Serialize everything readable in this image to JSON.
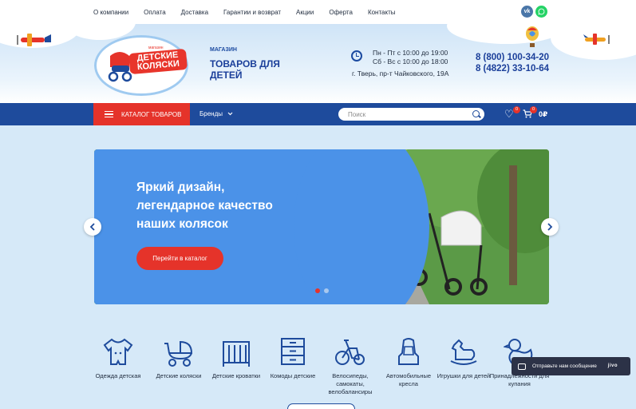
{
  "topnav": {
    "items": [
      "О компании",
      "Оплата",
      "Доставка",
      "Гарантии и возврат",
      "Акции",
      "Оферта",
      "Контакты"
    ],
    "social": {
      "vk": "vk-icon",
      "whatsapp": "whatsapp-icon"
    }
  },
  "header": {
    "logo_small": "магазин",
    "logo_text": "ДЕТСКИЕ КОЛЯСКИ",
    "shop_label": "МАГАЗИН",
    "shop_title": "ТОВАРОВ ДЛЯ ДЕТЕЙ",
    "hours_line1": "Пн - Пт с 10:00 до 19:00",
    "hours_line2": "Сб - Вс с 10:00 до 18:00",
    "address": "г. Тверь, пр-т Чайковского, 19А",
    "phone1": "8 (800) 100-34-20",
    "phone2": "8 (4822) 33-10-64"
  },
  "navbar": {
    "catalog_label": "КАТАЛОГ ТОВАРОВ",
    "brands_label": "Бренды",
    "search_placeholder": "Поиск",
    "favorites_count": "0",
    "cart_count": "0",
    "cart_total": "0₽"
  },
  "banner": {
    "title": "Яркий дизайн, легендарное качество наших колясок",
    "button_label": "Перейти в каталог",
    "slides": 2,
    "active_slide": 1
  },
  "categories": [
    {
      "label": "Одежда детская",
      "icon": "onesie-icon"
    },
    {
      "label": "Детские коляски",
      "icon": "stroller-icon"
    },
    {
      "label": "Детские кроватки",
      "icon": "crib-icon"
    },
    {
      "label": "Комоды детские",
      "icon": "dresser-icon"
    },
    {
      "label": "Велосипеды, самокаты, велобалансиры",
      "icon": "bicycle-icon"
    },
    {
      "label": "Автомобильные кресла",
      "icon": "car-seat-icon"
    },
    {
      "label": "Игрушки для детей",
      "icon": "rocking-horse-icon"
    },
    {
      "label": "Принадлежности для купания",
      "icon": "duck-icon"
    }
  ],
  "chat": {
    "message": "Отправьте нам сообщение",
    "brand": "jivo"
  },
  "colors": {
    "brand_blue": "#1e4b9c",
    "accent_red": "#e5332a",
    "banner_blue": "#4b92e8",
    "page_bg": "#d6e9f8"
  }
}
